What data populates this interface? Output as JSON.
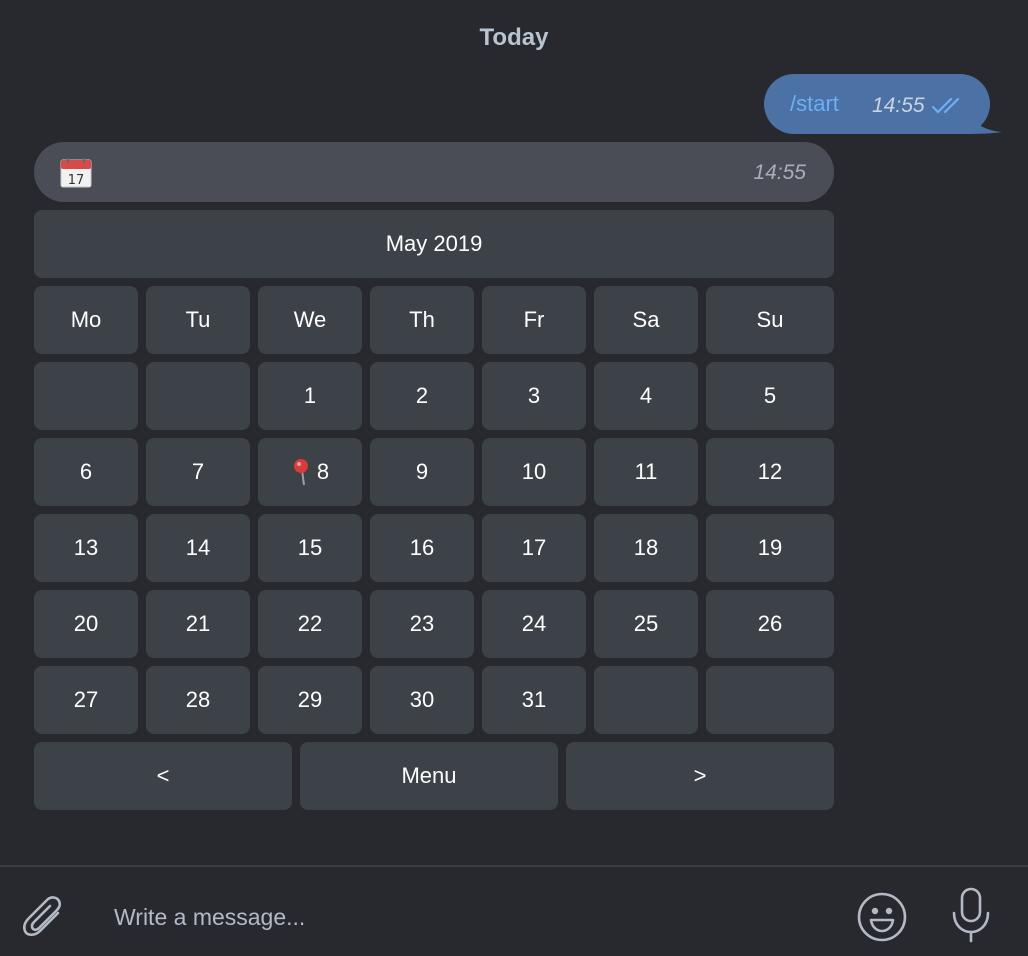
{
  "chat": {
    "date_separator": "Today",
    "outgoing": {
      "text": "/start",
      "time": "14:55",
      "status_icon": "double-check-icon"
    },
    "incoming": {
      "icon": "calendar-icon",
      "time": "14:55"
    }
  },
  "keyboard": {
    "month_label": "May 2019",
    "weekdays": [
      "Mo",
      "Tu",
      "We",
      "Th",
      "Fr",
      "Sa",
      "Su"
    ],
    "weeks": [
      [
        "",
        "",
        "1",
        "2",
        "3",
        "4",
        "5"
      ],
      [
        "6",
        "7",
        "8",
        "9",
        "10",
        "11",
        "12"
      ],
      [
        "13",
        "14",
        "15",
        "16",
        "17",
        "18",
        "19"
      ],
      [
        "20",
        "21",
        "22",
        "23",
        "24",
        "25",
        "26"
      ],
      [
        "27",
        "28",
        "29",
        "30",
        "31",
        "",
        ""
      ]
    ],
    "marked_day": {
      "day": "8",
      "icon": "pushpin-icon"
    },
    "nav": {
      "prev": "<",
      "menu": "Menu",
      "next": ">"
    }
  },
  "composer": {
    "placeholder": "Write a message...",
    "icons": [
      "paperclip-icon",
      "emoji-icon",
      "microphone-icon"
    ]
  },
  "colors": {
    "background": "#28292e",
    "outgoing_bubble": "#4c71a5",
    "incoming_bubble": "#4a4d56",
    "keyboard_button": "#3d4248",
    "link_blue": "#69b0f5"
  }
}
